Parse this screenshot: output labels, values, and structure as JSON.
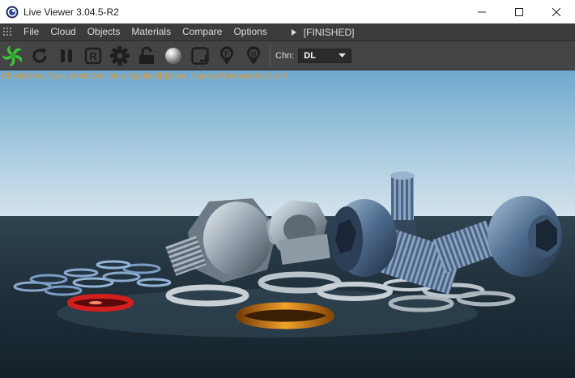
{
  "window": {
    "title": "Live Viewer 3.04.5-R2",
    "controls": {
      "minimize": "minimize-icon",
      "maximize": "maximize-icon",
      "close": "close-icon"
    }
  },
  "menu": {
    "items": [
      "File",
      "Cloud",
      "Objects",
      "Materials",
      "Compare",
      "Options"
    ],
    "status": "[FINISHED]"
  },
  "toolbar": {
    "buttons": [
      {
        "icon": "octane-logo-icon",
        "color": "#3cc43c"
      },
      {
        "icon": "refresh-icon"
      },
      {
        "icon": "pause-icon"
      },
      {
        "icon": "region-render-icon",
        "letter": "R"
      },
      {
        "icon": "settings-gear-icon"
      },
      {
        "icon": "lock-open-icon"
      },
      {
        "icon": "material-sphere-icon"
      },
      {
        "icon": "focus-picker-icon"
      },
      {
        "icon": "focus-pin-icon",
        "letter": "F"
      },
      {
        "icon": "material-pin-icon",
        "letter": "M"
      }
    ],
    "channel_label": "Chn:",
    "channel_value": "DL"
  },
  "viewport": {
    "stats": "Check:0ms./1ms. MeshGen:0ms. Update[E]:0ms. Nodes:66 Movable:21  0 0"
  },
  "colors": {
    "stats_text": "#e89a2a",
    "menubar_bg": "#3c3c3c",
    "toolbar_bg": "#444444"
  }
}
